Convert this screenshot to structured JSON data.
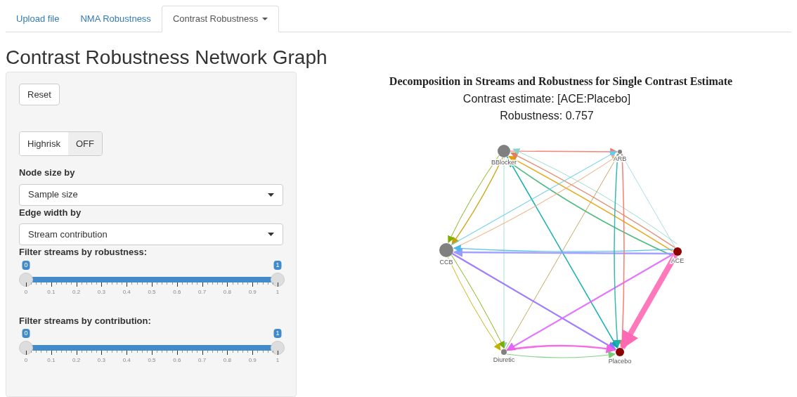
{
  "tabs": [
    {
      "label": "Upload file",
      "selected": false,
      "dropdown": false
    },
    {
      "label": "NMA Robustness",
      "selected": false,
      "dropdown": false
    },
    {
      "label": "Contrast Robustness",
      "selected": true,
      "dropdown": true
    }
  ],
  "page_title": "Contrast Robustness Network Graph",
  "sidebar": {
    "reset_button": "Reset",
    "toggle": {
      "label": "Highrisk",
      "state_text": "OFF",
      "on": false
    },
    "selects": [
      {
        "label": "Node size by",
        "value": "Sample size"
      },
      {
        "label": "Edge width by",
        "value": "Stream contribution"
      }
    ],
    "sliders": [
      {
        "label": "Filter streams by robustness:",
        "thumbs": [
          {
            "label": "0",
            "level": 0
          },
          {
            "label": "1",
            "level": 1
          }
        ],
        "ticks": [
          "0",
          "0.1",
          "0.2",
          "0.3",
          "0.4",
          "0.5",
          "0.6",
          "0.7",
          "0.8",
          "0.9",
          "1"
        ]
      },
      {
        "label": "Filter streams by contribution:",
        "thumbs": [
          {
            "label": "0",
            "level": 0
          },
          {
            "label": "1",
            "level": 1
          }
        ],
        "ticks": [
          "0",
          "0.1",
          "0.2",
          "0.3",
          "0.4",
          "0.5",
          "0.6",
          "0.7",
          "0.8",
          "0.9",
          "1"
        ]
      }
    ]
  },
  "graph": {
    "title": "Decomposition in Streams and Robustness for Single Contrast Estimate",
    "subtitle": "Contrast estimate: [ACE:Placebo]",
    "robustness": "Robustness: 0.757",
    "nodes": [
      {
        "label": "BBlocker",
        "highlighted": false
      },
      {
        "label": "ARB",
        "highlighted": false
      },
      {
        "label": "CCB",
        "highlighted": false
      },
      {
        "label": "ACE",
        "highlighted": true
      },
      {
        "label": "Diuretic",
        "highlighted": false
      },
      {
        "label": "Placebo",
        "highlighted": true
      }
    ]
  }
}
